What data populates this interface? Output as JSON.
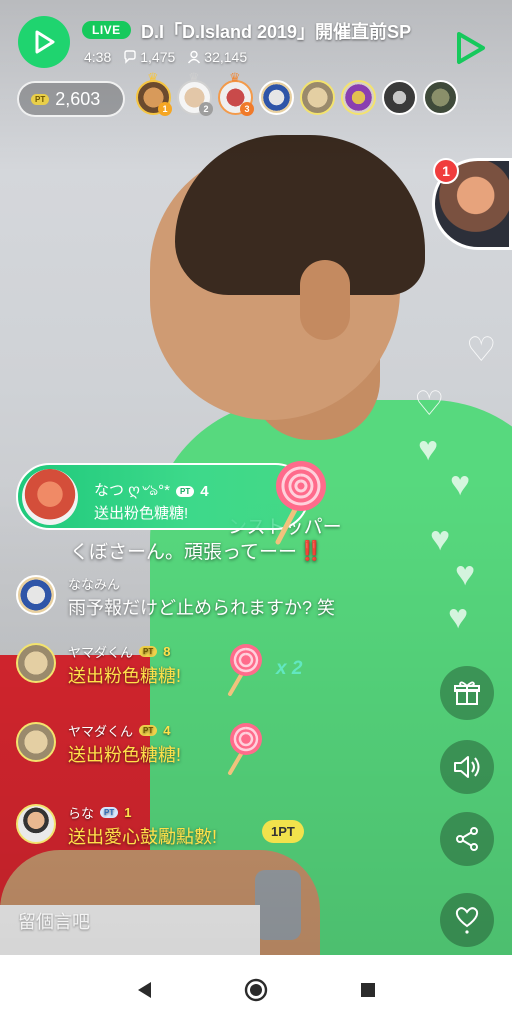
{
  "header": {
    "live_label": "LIVE",
    "title": "D.I「D.Island 2019」開催直前SP",
    "duration": "4:38",
    "comments": "1,475",
    "viewers": "32,145"
  },
  "points": {
    "tag": "PT",
    "value": "2,603"
  },
  "top_viewers": {
    "ranks": [
      "1",
      "2",
      "3"
    ]
  },
  "host": {
    "badge_count": "1"
  },
  "gift_highlight": {
    "name": "なつ ღ৺ঌ°*",
    "pt_tag": "PT",
    "pt_count": "4",
    "message": "送出粉色糖糖!"
  },
  "partial_comment": {
    "text_line1": "ンストッパー",
    "text_line2": "くぼさーん。頑張ってーー",
    "emoji": "‼️"
  },
  "comments": [
    {
      "name": "ななみん",
      "message": "雨予報だけど止められますか? 笑",
      "pt_tag": "",
      "pt": ""
    },
    {
      "name": "ヤマダくん",
      "message": "送出粉色糖糖!",
      "pt_tag": "PT",
      "pt": "8"
    },
    {
      "name": "ヤマダくん",
      "message": "送出粉色糖糖!",
      "pt_tag": "PT",
      "pt": "4"
    },
    {
      "name": "らな",
      "message": "送出愛心鼓勵點數!",
      "pt_tag": "PT",
      "pt": "1"
    }
  ],
  "combo": "x 2",
  "pt_chip": "1PT",
  "input": {
    "placeholder": "留個言吧"
  },
  "colors": {
    "accent": "#16c95c",
    "gold_text": "#ffe14a",
    "highlight": "#1fc97c"
  },
  "icons": {
    "logo": "line-live-logo",
    "gift": "gift-icon",
    "sound": "speaker-icon",
    "share": "share-icon",
    "like": "heart-icon",
    "nav_back": "back-triangle-icon",
    "nav_home": "home-circle-icon",
    "nav_recents": "recents-square-icon"
  }
}
